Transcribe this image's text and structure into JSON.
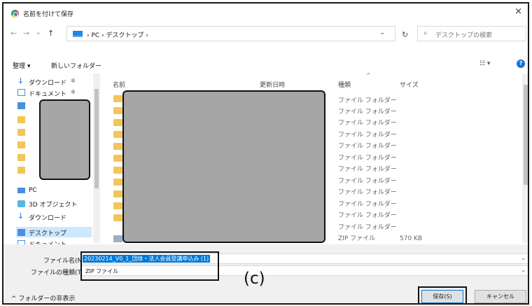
{
  "window": {
    "title": "名前を付けて保存",
    "close": "×"
  },
  "nav": {
    "back": "←",
    "forward": "→",
    "recent": "⌄",
    "up": "↑",
    "breadcrumbs": "› PC › デスクトップ ›",
    "address_dropdown": "⌄",
    "refresh": "↻",
    "search_placeholder": "デスクトップの検索",
    "search_glyph": "⌕"
  },
  "toolbar": {
    "organize": "整理 ▾",
    "new_folder": "新しいフォルダー",
    "view": "☷ ▾",
    "help": "?"
  },
  "sidebar": {
    "items": [
      {
        "label": "ダウンロード",
        "icon": "download-icon"
      },
      {
        "label": "ドキュメント",
        "icon": "document-icon"
      },
      {
        "label": "PC",
        "icon": "pc-icon"
      },
      {
        "label": "3D オブジェクト",
        "icon": "3d-objects-icon"
      },
      {
        "label": "ダウンロード",
        "icon": "download-icon"
      },
      {
        "label": "デスクトップ",
        "icon": "desktop-icon"
      },
      {
        "label": "ドキュメント",
        "icon": "document-icon"
      }
    ],
    "pin": "✲"
  },
  "columns": {
    "name": "名前",
    "modified": "更新日時",
    "type": "種類",
    "size": "サイズ",
    "sort_glyph": "^"
  },
  "file_list": {
    "types": [
      "ファイル フォルダー",
      "ファイル フォルダー",
      "ファイル フォルダー",
      "ファイル フォルダー",
      "ファイル フォルダー",
      "ファイル フォルダー",
      "ファイル フォルダー",
      "ファイル フォルダー",
      "ファイル フォルダー",
      "ファイル フォルダー",
      "ファイル フォルダー",
      "ファイル フォルダー",
      "ZIP ファイル"
    ],
    "zip_size": "570 KB"
  },
  "form": {
    "filename_label": "ファイル名(N):",
    "filename_value": "20230214_V0_1_団体・法人会員受講申込み (1)",
    "filetype_label": "ファイルの種類(T):",
    "filetype_value": "ZIP ファイル",
    "dropdown": "⌄"
  },
  "annotation": {
    "callout": "(c)"
  },
  "footer": {
    "hide_folders": "^ フォルダーの非表示",
    "save": "保存(S)",
    "cancel": "キャンセル"
  }
}
